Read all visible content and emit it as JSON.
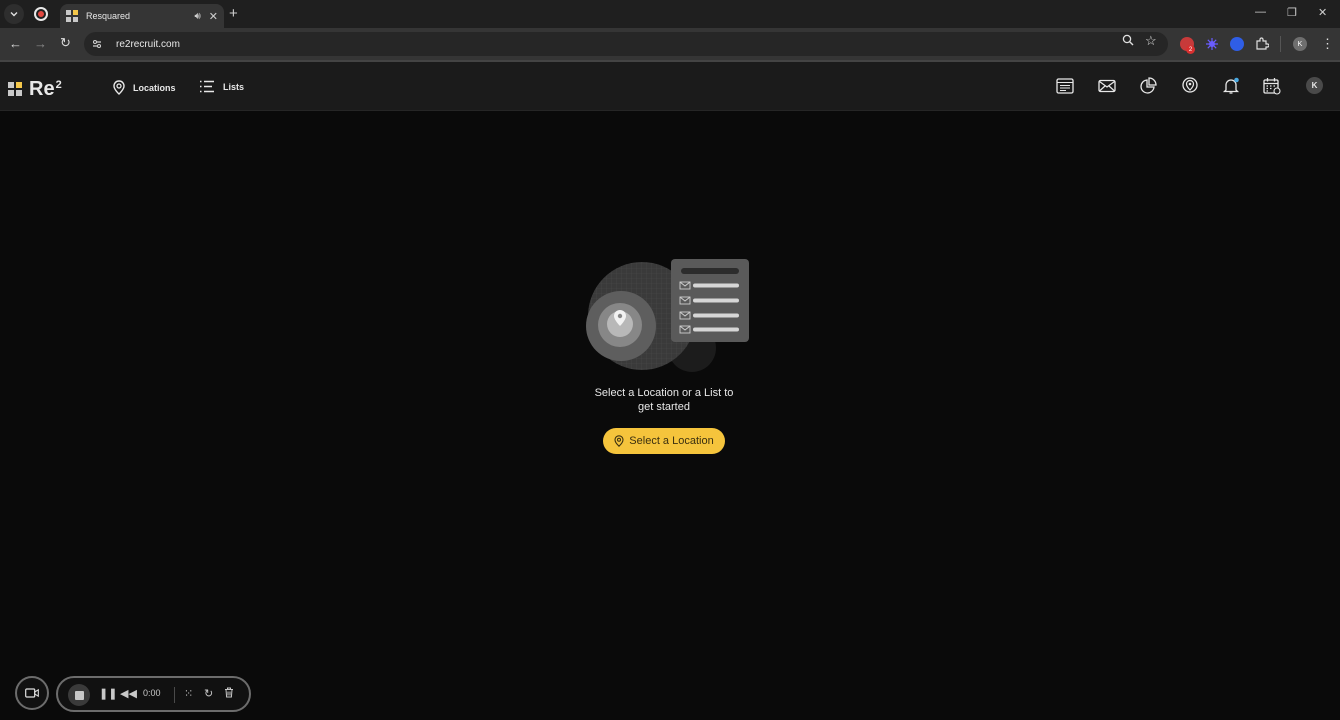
{
  "browser": {
    "tab_title": "Resquared",
    "url": "re2recruit.com",
    "profile_initial": "K",
    "extension_badge": "2"
  },
  "app": {
    "logo_text": "Re",
    "logo_sup": "2",
    "nav": [
      {
        "label": "Locations",
        "icon": "map-pin-icon"
      },
      {
        "label": "Lists",
        "icon": "list-icon"
      }
    ],
    "header_icons": [
      "browser-window-icon",
      "mail-icon",
      "pie-chart-icon",
      "location-bulb-icon",
      "bell-icon",
      "calendar-icon"
    ],
    "avatar_initial": "K",
    "accent": "#f5c43c"
  },
  "empty_state": {
    "line1": "Select a Location or a List to",
    "line2": "get started",
    "button_label": "Select a Location"
  },
  "recorder": {
    "time": "0:00"
  }
}
